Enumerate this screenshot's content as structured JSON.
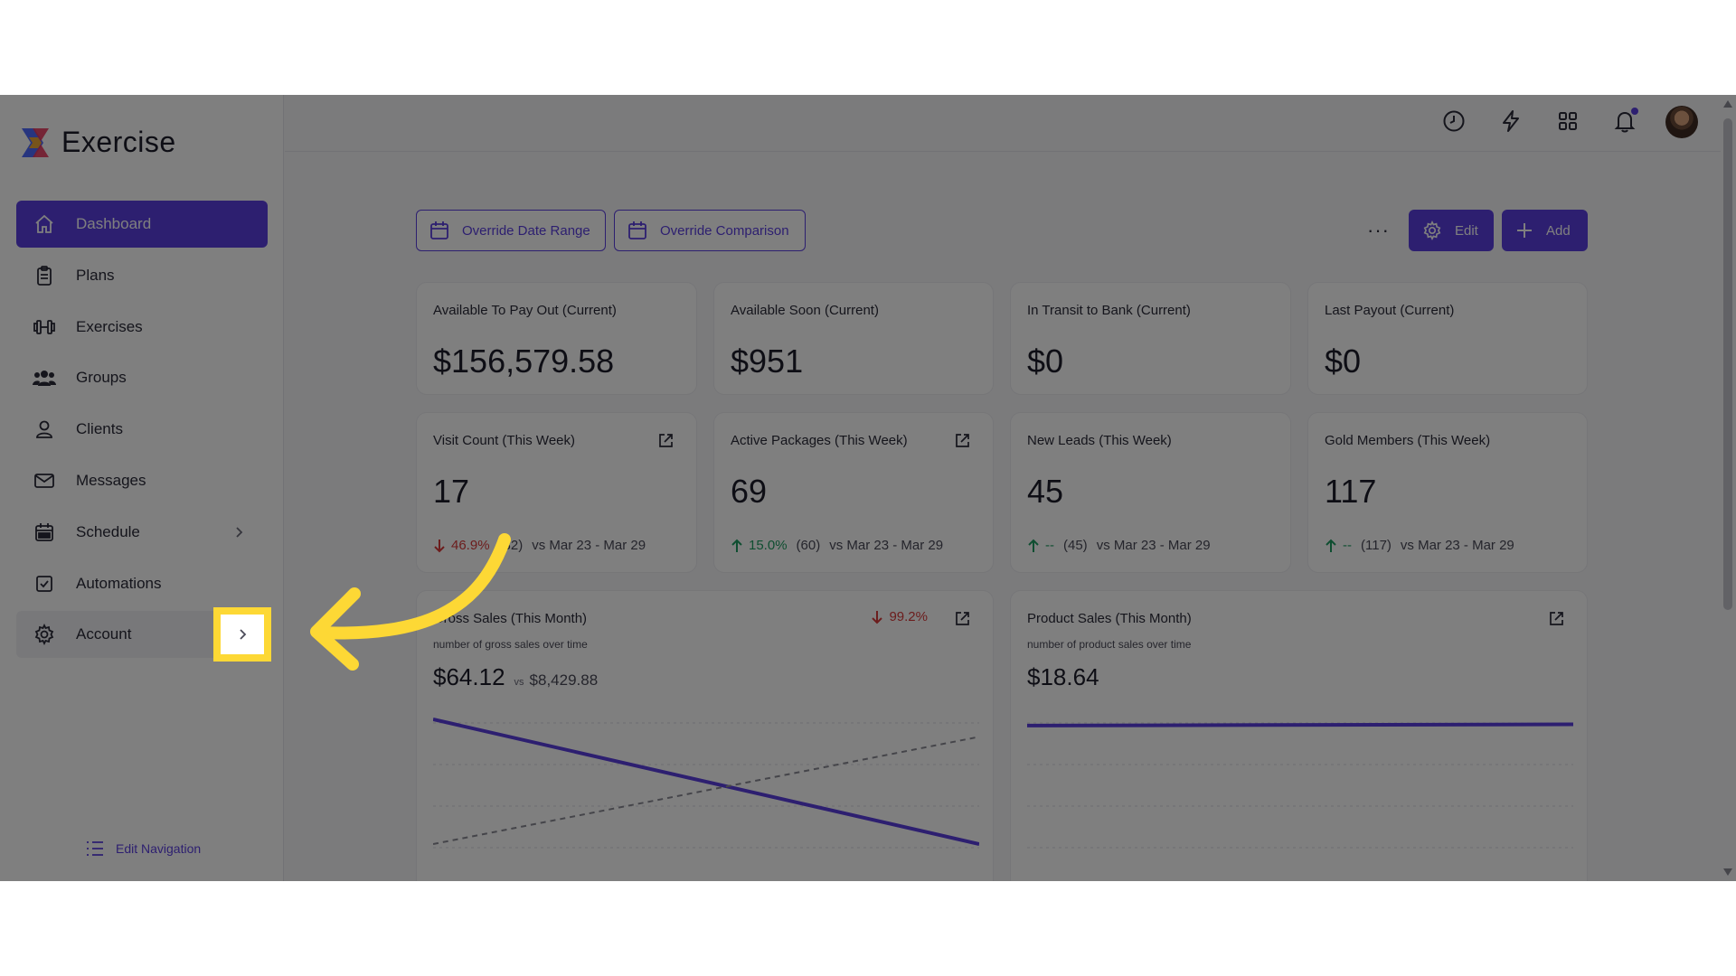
{
  "app": {
    "name": "Exercise",
    "accent": "#5b3fe0"
  },
  "sidebar": {
    "items": [
      {
        "label": "Dashboard",
        "icon": "home-icon"
      },
      {
        "label": "Plans",
        "icon": "clipboard-icon"
      },
      {
        "label": "Exercises",
        "icon": "dumbbell-icon"
      },
      {
        "label": "Groups",
        "icon": "users-icon"
      },
      {
        "label": "Clients",
        "icon": "user-icon"
      },
      {
        "label": "Messages",
        "icon": "mail-icon"
      },
      {
        "label": "Schedule",
        "icon": "calendar-icon"
      },
      {
        "label": "Automations",
        "icon": "checkbox-icon"
      },
      {
        "label": "Account",
        "icon": "gear-icon"
      }
    ],
    "edit_navigation": "Edit Navigation"
  },
  "toolbar": {
    "override_date_range": "Override Date Range",
    "override_comparison": "Override Comparison",
    "more": "···",
    "edit": "Edit",
    "add": "Add"
  },
  "summary_cards": [
    {
      "label": "Available To Pay Out (Current)",
      "value": "$156,579.58"
    },
    {
      "label": "Available Soon (Current)",
      "value": "$951"
    },
    {
      "label": "In Transit to Bank (Current)",
      "value": "$0"
    },
    {
      "label": "Last Payout (Current)",
      "value": "$0"
    }
  ],
  "metric_cards": [
    {
      "label": "Visit Count (This Week)",
      "value": "17",
      "direction": "down",
      "pct": "46.9%",
      "prev": "(32)",
      "range": "vs Mar 23 - Mar 29"
    },
    {
      "label": "Active Packages (This Week)",
      "value": "69",
      "direction": "up",
      "pct": "15.0%",
      "prev": "(60)",
      "range": "vs Mar 23 - Mar 29"
    },
    {
      "label": "New Leads (This Week)",
      "value": "45",
      "direction": "up",
      "pct": "--",
      "prev": "(45)",
      "range": "vs Mar 23 - Mar 29"
    },
    {
      "label": "Gold Members (This Week)",
      "value": "117",
      "direction": "up",
      "pct": "--",
      "prev": "(117)",
      "range": "vs Mar 23 - Mar 29"
    }
  ],
  "chart_cards": [
    {
      "label": "Gross Sales (This Month)",
      "subtitle": "number of gross sales over time",
      "value": "$64.12",
      "vs": "vs",
      "comparison": "$8,429.88",
      "direction": "down",
      "pct": "99.2%"
    },
    {
      "label": "Product Sales (This Month)",
      "subtitle": "number of product sales over time",
      "value": "$18.64"
    }
  ],
  "chart_data": [
    {
      "type": "line",
      "title": "Gross Sales (This Month)",
      "series": [
        {
          "values": [
            1.0,
            0.0
          ]
        },
        {
          "values": [
            0.0,
            0.86
          ]
        }
      ]
    },
    {
      "type": "line",
      "title": "Product Sales (This Month)",
      "series": [
        {
          "values": [
            0.95,
            0.96
          ]
        }
      ]
    }
  ]
}
